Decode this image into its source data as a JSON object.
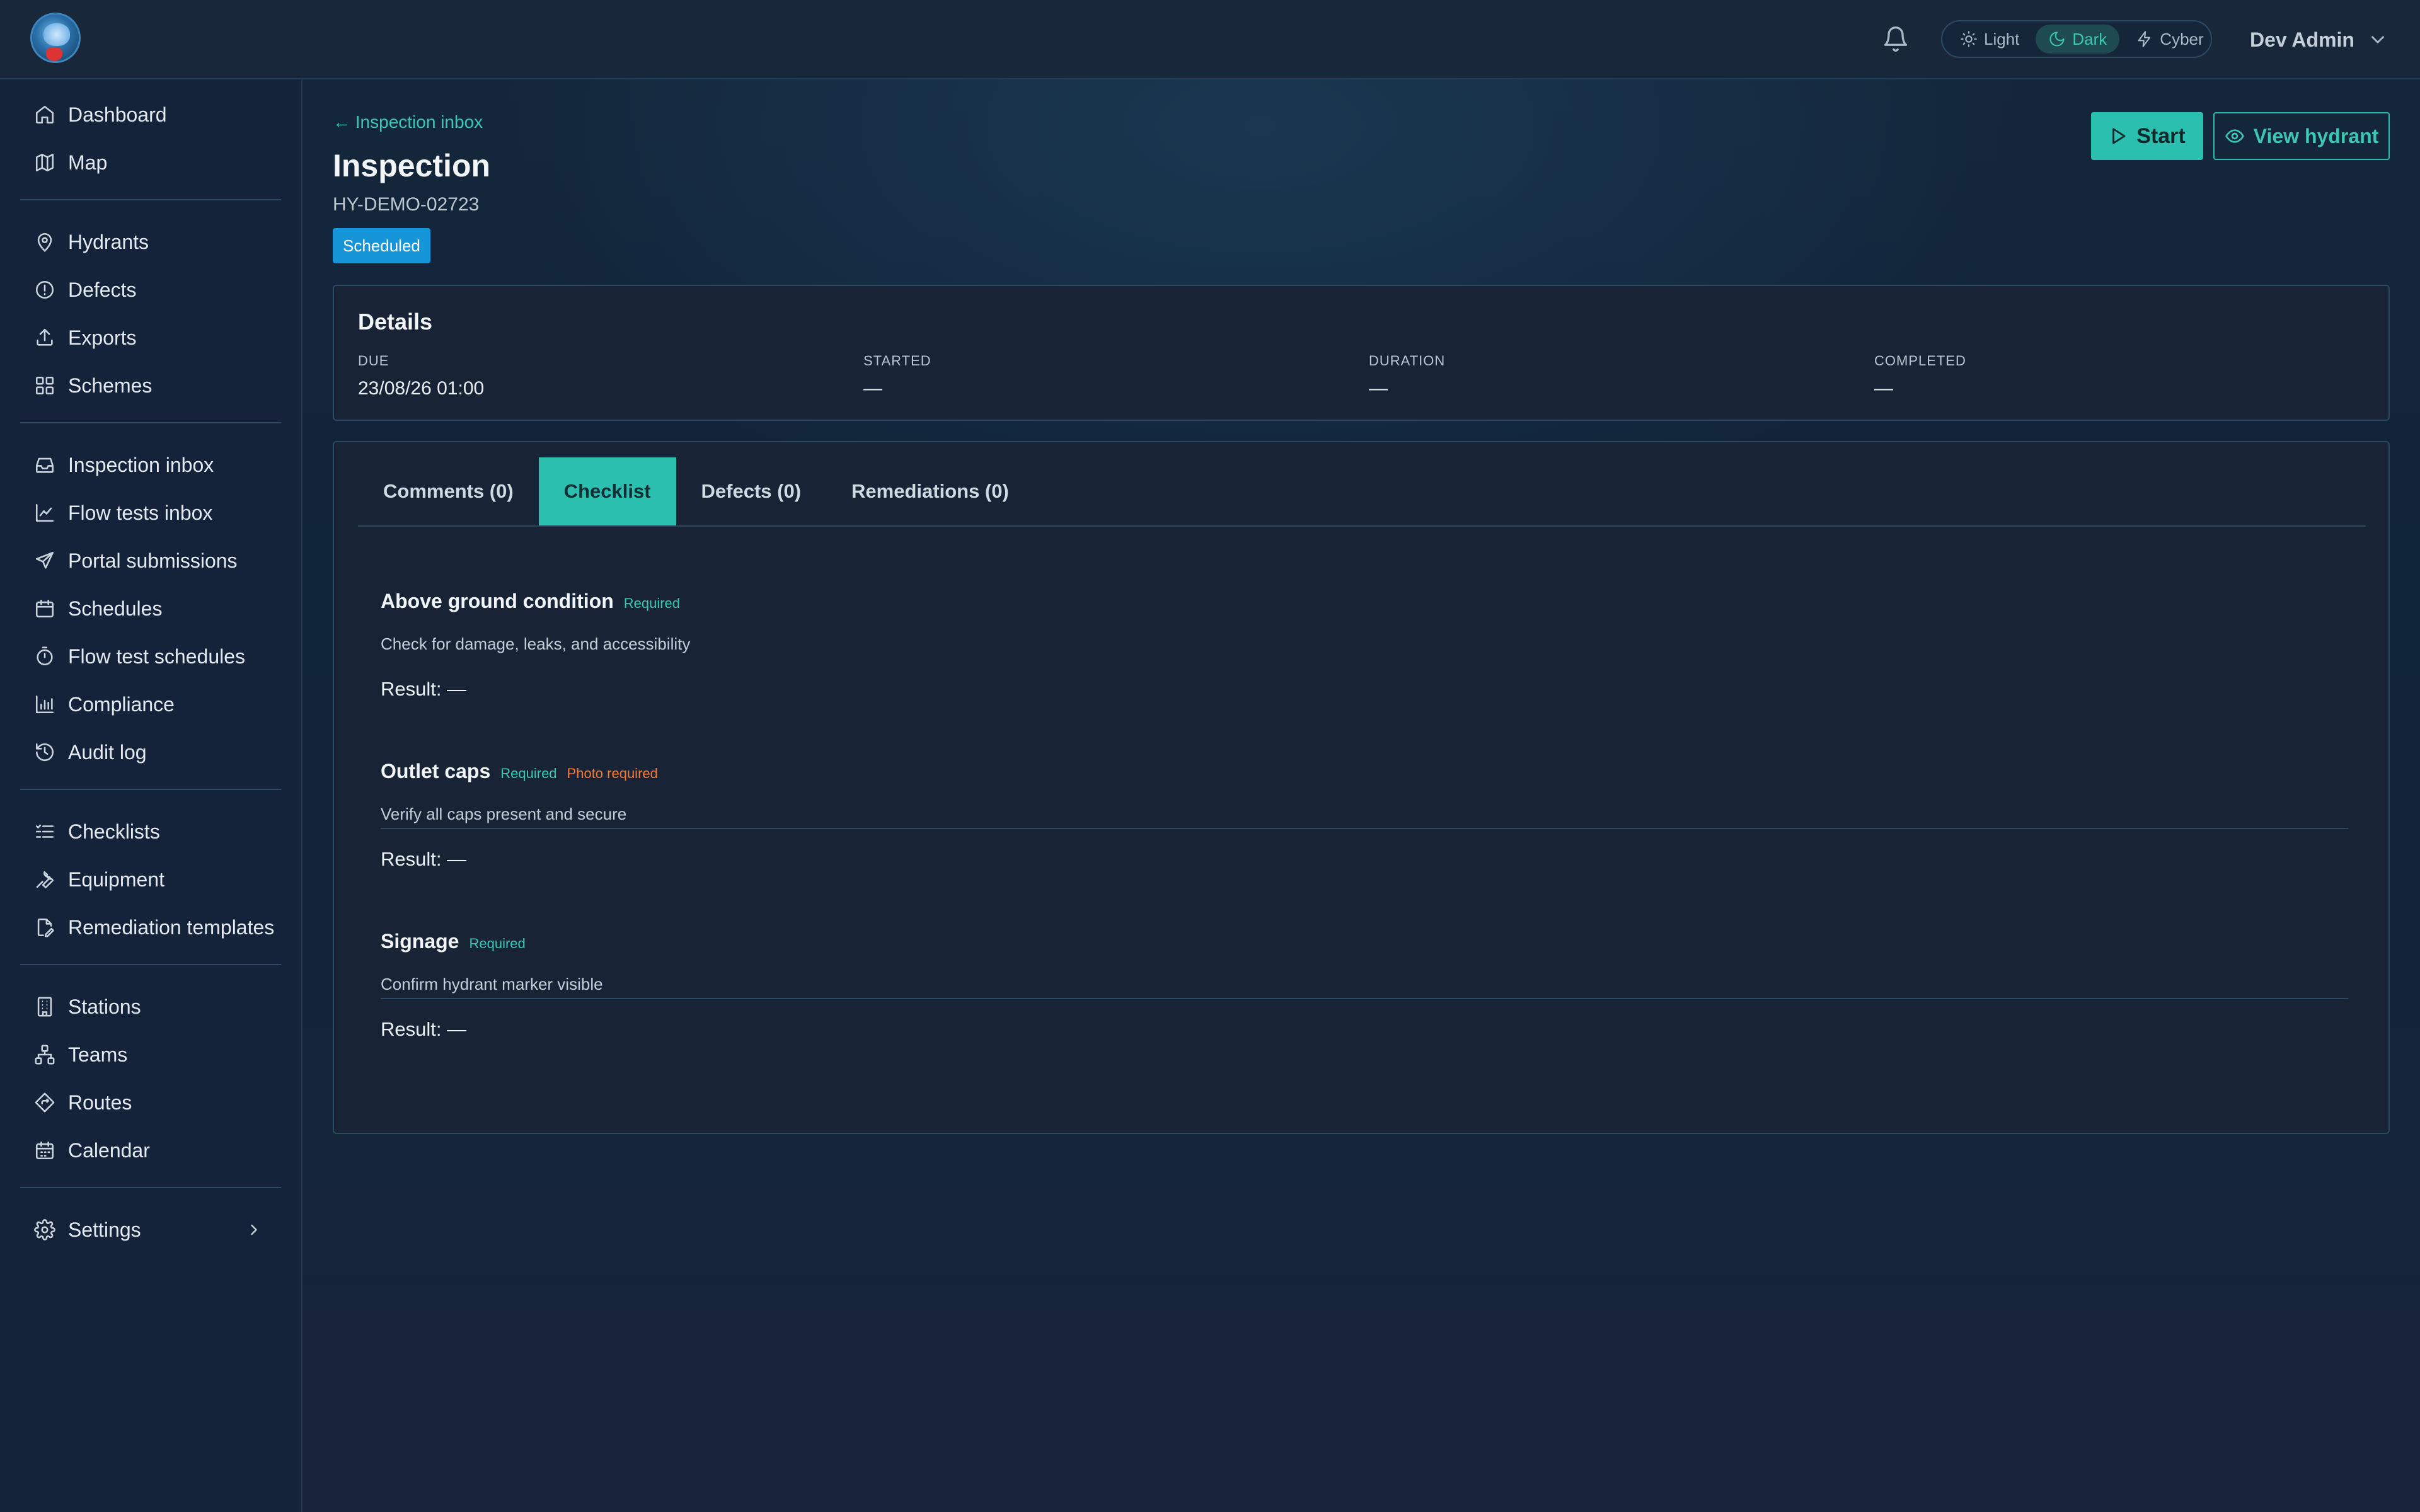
{
  "header": {
    "theme_options": [
      {
        "label": "Light",
        "icon": "sun-icon"
      },
      {
        "label": "Dark",
        "icon": "moon-icon",
        "active": true
      },
      {
        "label": "Cyber",
        "icon": "bolt-icon"
      }
    ],
    "user_name": "Dev Admin"
  },
  "sidebar": {
    "groups": [
      [
        {
          "label": "Dashboard",
          "icon": "home-icon"
        },
        {
          "label": "Map",
          "icon": "map-icon"
        }
      ],
      [
        {
          "label": "Hydrants",
          "icon": "pin-icon"
        },
        {
          "label": "Defects",
          "icon": "alert-circle-icon"
        },
        {
          "label": "Exports",
          "icon": "upload-icon"
        },
        {
          "label": "Schemes",
          "icon": "grid-icon"
        }
      ],
      [
        {
          "label": "Inspection inbox",
          "icon": "inbox-icon"
        },
        {
          "label": "Flow tests inbox",
          "icon": "trend-icon"
        },
        {
          "label": "Portal submissions",
          "icon": "send-icon"
        },
        {
          "label": "Schedules",
          "icon": "calendar-icon"
        },
        {
          "label": "Flow test schedules",
          "icon": "timer-icon"
        },
        {
          "label": "Compliance",
          "icon": "bar-chart-icon"
        },
        {
          "label": "Audit log",
          "icon": "history-icon"
        }
      ],
      [
        {
          "label": "Checklists",
          "icon": "list-checks-icon"
        },
        {
          "label": "Equipment",
          "icon": "wrench-icon"
        },
        {
          "label": "Remediation templates",
          "icon": "file-edit-icon"
        }
      ],
      [
        {
          "label": "Stations",
          "icon": "building-icon"
        },
        {
          "label": "Teams",
          "icon": "network-icon"
        },
        {
          "label": "Routes",
          "icon": "route-icon"
        },
        {
          "label": "Calendar",
          "icon": "calendar-days-icon"
        }
      ],
      [
        {
          "label": "Settings",
          "icon": "gear-icon"
        }
      ]
    ]
  },
  "page": {
    "back_link": "← Inspection inbox",
    "title": "Inspection",
    "subtitle": "HY-DEMO-02723",
    "status": "Scheduled",
    "start_label": "Start",
    "view_label": "View hydrant"
  },
  "details": {
    "title": "Details",
    "fields": [
      {
        "label": "DUE",
        "value": "23/08/26 01:00"
      },
      {
        "label": "STARTED",
        "value": "—"
      },
      {
        "label": "DURATION",
        "value": "—"
      },
      {
        "label": "COMPLETED",
        "value": "—"
      }
    ]
  },
  "tabs": [
    {
      "label": "Comments (0)"
    },
    {
      "label": "Checklist",
      "active": true
    },
    {
      "label": "Defects (0)"
    },
    {
      "label": "Remediations (0)"
    }
  ],
  "checklist": [
    {
      "title": "Above ground condition",
      "required": "Required",
      "photo": "",
      "description": "Check for damage, leaks, and accessibility",
      "result": "Result: —"
    },
    {
      "title": "Outlet caps",
      "required": "Required",
      "photo": "Photo required",
      "description": "Verify all caps present and secure",
      "result": "Result: —"
    },
    {
      "title": "Signage",
      "required": "Required",
      "photo": "",
      "description": "Confirm hydrant marker visible",
      "result": "Result: —"
    }
  ],
  "colors": {
    "accent": "#2abfae",
    "status_blue": "#1696d8",
    "photo_tag": "#f0793a"
  }
}
